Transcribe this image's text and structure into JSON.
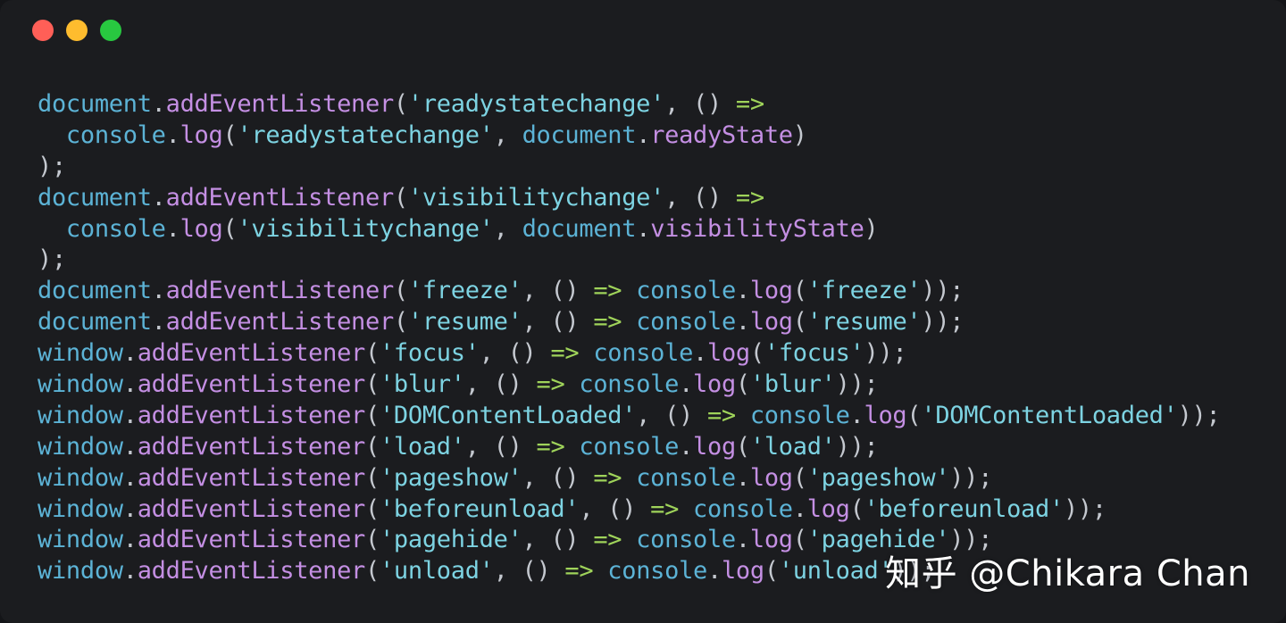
{
  "window": {
    "controls": [
      {
        "name": "close",
        "color": "#ff5f57"
      },
      {
        "name": "minimize",
        "color": "#febc2e"
      },
      {
        "name": "zoom",
        "color": "#28c840"
      }
    ]
  },
  "code_lines": [
    [
      [
        "obj",
        "document"
      ],
      [
        "punc",
        "."
      ],
      [
        "fn",
        "addEventListener"
      ],
      [
        "punc",
        "("
      ],
      [
        "str",
        "'readystatechange'"
      ],
      [
        "punc",
        ", () "
      ],
      [
        "arrow",
        "=>"
      ]
    ],
    [
      [
        "punc",
        "  "
      ],
      [
        "obj",
        "console"
      ],
      [
        "punc",
        "."
      ],
      [
        "fn",
        "log"
      ],
      [
        "punc",
        "("
      ],
      [
        "str",
        "'readystatechange'"
      ],
      [
        "punc",
        ", "
      ],
      [
        "obj",
        "document"
      ],
      [
        "punc",
        "."
      ],
      [
        "fn",
        "readyState"
      ],
      [
        "punc",
        ")"
      ]
    ],
    [
      [
        "punc",
        ");"
      ]
    ],
    [
      [
        "obj",
        "document"
      ],
      [
        "punc",
        "."
      ],
      [
        "fn",
        "addEventListener"
      ],
      [
        "punc",
        "("
      ],
      [
        "str",
        "'visibilitychange'"
      ],
      [
        "punc",
        ", () "
      ],
      [
        "arrow",
        "=>"
      ]
    ],
    [
      [
        "punc",
        "  "
      ],
      [
        "obj",
        "console"
      ],
      [
        "punc",
        "."
      ],
      [
        "fn",
        "log"
      ],
      [
        "punc",
        "("
      ],
      [
        "str",
        "'visibilitychange'"
      ],
      [
        "punc",
        ", "
      ],
      [
        "obj",
        "document"
      ],
      [
        "punc",
        "."
      ],
      [
        "fn",
        "visibilityState"
      ],
      [
        "punc",
        ")"
      ]
    ],
    [
      [
        "punc",
        ");"
      ]
    ],
    [
      [
        "obj",
        "document"
      ],
      [
        "punc",
        "."
      ],
      [
        "fn",
        "addEventListener"
      ],
      [
        "punc",
        "("
      ],
      [
        "str",
        "'freeze'"
      ],
      [
        "punc",
        ", () "
      ],
      [
        "arrow",
        "=>"
      ],
      [
        "punc",
        " "
      ],
      [
        "obj",
        "console"
      ],
      [
        "punc",
        "."
      ],
      [
        "fn",
        "log"
      ],
      [
        "punc",
        "("
      ],
      [
        "str",
        "'freeze'"
      ],
      [
        "punc",
        "));"
      ]
    ],
    [
      [
        "obj",
        "document"
      ],
      [
        "punc",
        "."
      ],
      [
        "fn",
        "addEventListener"
      ],
      [
        "punc",
        "("
      ],
      [
        "str",
        "'resume'"
      ],
      [
        "punc",
        ", () "
      ],
      [
        "arrow",
        "=>"
      ],
      [
        "punc",
        " "
      ],
      [
        "obj",
        "console"
      ],
      [
        "punc",
        "."
      ],
      [
        "fn",
        "log"
      ],
      [
        "punc",
        "("
      ],
      [
        "str",
        "'resume'"
      ],
      [
        "punc",
        "));"
      ]
    ],
    [
      [
        "obj",
        "window"
      ],
      [
        "punc",
        "."
      ],
      [
        "fn",
        "addEventListener"
      ],
      [
        "punc",
        "("
      ],
      [
        "str",
        "'focus'"
      ],
      [
        "punc",
        ", () "
      ],
      [
        "arrow",
        "=>"
      ],
      [
        "punc",
        " "
      ],
      [
        "obj",
        "console"
      ],
      [
        "punc",
        "."
      ],
      [
        "fn",
        "log"
      ],
      [
        "punc",
        "("
      ],
      [
        "str",
        "'focus'"
      ],
      [
        "punc",
        "));"
      ]
    ],
    [
      [
        "obj",
        "window"
      ],
      [
        "punc",
        "."
      ],
      [
        "fn",
        "addEventListener"
      ],
      [
        "punc",
        "("
      ],
      [
        "str",
        "'blur'"
      ],
      [
        "punc",
        ", () "
      ],
      [
        "arrow",
        "=>"
      ],
      [
        "punc",
        " "
      ],
      [
        "obj",
        "console"
      ],
      [
        "punc",
        "."
      ],
      [
        "fn",
        "log"
      ],
      [
        "punc",
        "("
      ],
      [
        "str",
        "'blur'"
      ],
      [
        "punc",
        "));"
      ]
    ],
    [
      [
        "obj",
        "window"
      ],
      [
        "punc",
        "."
      ],
      [
        "fn",
        "addEventListener"
      ],
      [
        "punc",
        "("
      ],
      [
        "str",
        "'DOMContentLoaded'"
      ],
      [
        "punc",
        ", () "
      ],
      [
        "arrow",
        "=>"
      ],
      [
        "punc",
        " "
      ],
      [
        "obj",
        "console"
      ],
      [
        "punc",
        "."
      ],
      [
        "fn",
        "log"
      ],
      [
        "punc",
        "("
      ],
      [
        "str",
        "'DOMContentLoaded'"
      ],
      [
        "punc",
        "));"
      ]
    ],
    [
      [
        "obj",
        "window"
      ],
      [
        "punc",
        "."
      ],
      [
        "fn",
        "addEventListener"
      ],
      [
        "punc",
        "("
      ],
      [
        "str",
        "'load'"
      ],
      [
        "punc",
        ", () "
      ],
      [
        "arrow",
        "=>"
      ],
      [
        "punc",
        " "
      ],
      [
        "obj",
        "console"
      ],
      [
        "punc",
        "."
      ],
      [
        "fn",
        "log"
      ],
      [
        "punc",
        "("
      ],
      [
        "str",
        "'load'"
      ],
      [
        "punc",
        "));"
      ]
    ],
    [
      [
        "obj",
        "window"
      ],
      [
        "punc",
        "."
      ],
      [
        "fn",
        "addEventListener"
      ],
      [
        "punc",
        "("
      ],
      [
        "str",
        "'pageshow'"
      ],
      [
        "punc",
        ", () "
      ],
      [
        "arrow",
        "=>"
      ],
      [
        "punc",
        " "
      ],
      [
        "obj",
        "console"
      ],
      [
        "punc",
        "."
      ],
      [
        "fn",
        "log"
      ],
      [
        "punc",
        "("
      ],
      [
        "str",
        "'pageshow'"
      ],
      [
        "punc",
        "));"
      ]
    ],
    [
      [
        "obj",
        "window"
      ],
      [
        "punc",
        "."
      ],
      [
        "fn",
        "addEventListener"
      ],
      [
        "punc",
        "("
      ],
      [
        "str",
        "'beforeunload'"
      ],
      [
        "punc",
        ", () "
      ],
      [
        "arrow",
        "=>"
      ],
      [
        "punc",
        " "
      ],
      [
        "obj",
        "console"
      ],
      [
        "punc",
        "."
      ],
      [
        "fn",
        "log"
      ],
      [
        "punc",
        "("
      ],
      [
        "str",
        "'beforeunload'"
      ],
      [
        "punc",
        "));"
      ]
    ],
    [
      [
        "obj",
        "window"
      ],
      [
        "punc",
        "."
      ],
      [
        "fn",
        "addEventListener"
      ],
      [
        "punc",
        "("
      ],
      [
        "str",
        "'pagehide'"
      ],
      [
        "punc",
        ", () "
      ],
      [
        "arrow",
        "=>"
      ],
      [
        "punc",
        " "
      ],
      [
        "obj",
        "console"
      ],
      [
        "punc",
        "."
      ],
      [
        "fn",
        "log"
      ],
      [
        "punc",
        "("
      ],
      [
        "str",
        "'pagehide'"
      ],
      [
        "punc",
        "));"
      ]
    ],
    [
      [
        "obj",
        "window"
      ],
      [
        "punc",
        "."
      ],
      [
        "fn",
        "addEventListener"
      ],
      [
        "punc",
        "("
      ],
      [
        "str",
        "'unload'"
      ],
      [
        "punc",
        ", () "
      ],
      [
        "arrow",
        "=>"
      ],
      [
        "punc",
        " "
      ],
      [
        "obj",
        "console"
      ],
      [
        "punc",
        "."
      ],
      [
        "fn",
        "log"
      ],
      [
        "punc",
        "("
      ],
      [
        "str",
        "'unload'"
      ],
      [
        "punc",
        "));"
      ]
    ]
  ],
  "watermark": "知乎 @Chikara Chan"
}
